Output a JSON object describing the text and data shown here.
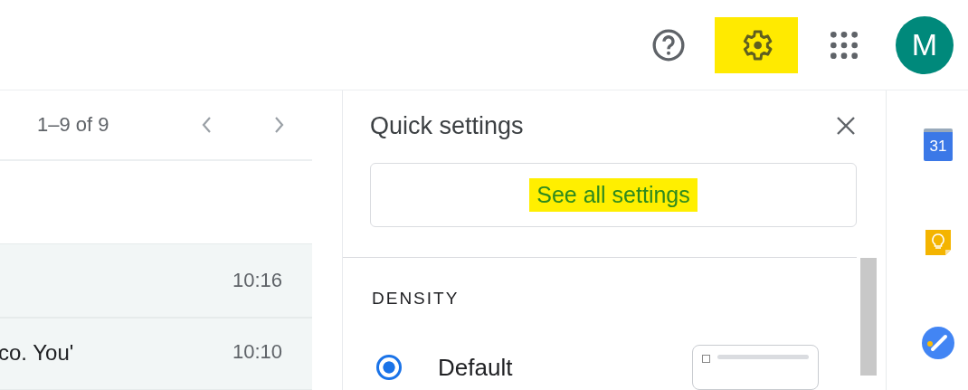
{
  "header": {
    "buttons": [
      {
        "kind": "help",
        "highlighted": false
      },
      {
        "kind": "settings",
        "highlighted": true
      },
      {
        "kind": "apps",
        "highlighted": false
      }
    ],
    "avatar": "M"
  },
  "mail": {
    "pagination": "1–9 of 9",
    "rows": [
      {
        "snippet": "",
        "time": "10:16"
      },
      {
        "snippet": "co. You'",
        "time": "10:10"
      }
    ]
  },
  "quick_settings": {
    "title": "Quick settings",
    "see_all": {
      "label": "See all settings",
      "highlighted": true
    },
    "section": "DENSITY",
    "options": [
      {
        "label": "Default",
        "selected": true
      }
    ]
  },
  "side_panel": {
    "apps": [
      {
        "kind": "calendar",
        "label": "31"
      },
      {
        "kind": "keep"
      },
      {
        "kind": "tasks"
      }
    ]
  }
}
